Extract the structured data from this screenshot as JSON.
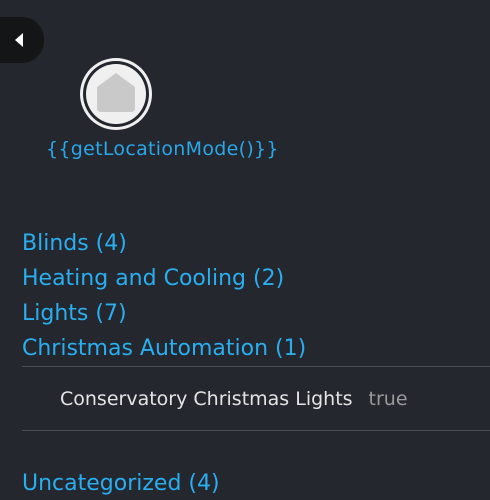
{
  "location_mode": {
    "icon": "house-icon",
    "label": "{{getLocationMode()}}"
  },
  "groups": [
    {
      "label": "Blinds (4)"
    },
    {
      "label": "Heating and Cooling (2)"
    },
    {
      "label": "Lights (7)"
    },
    {
      "label": "Christmas Automation (1)"
    }
  ],
  "christmas_devices": [
    {
      "name": "Conservatory Christmas Lights",
      "value": "true"
    }
  ],
  "uncategorized": {
    "label": "Uncategorized (4)"
  },
  "colors": {
    "background": "#24272e",
    "link": "#29aef0",
    "text": "#e4e4e4",
    "muted": "#9a9a9a"
  }
}
